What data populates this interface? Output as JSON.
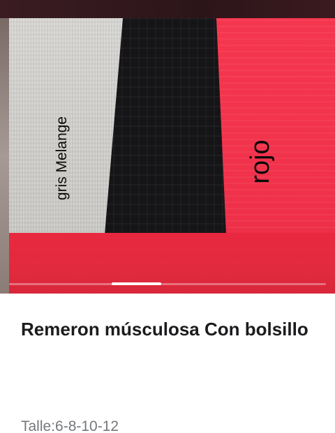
{
  "product": {
    "image": {
      "caption_left": "gris Melange",
      "caption_right": "rojo",
      "slide_index": 3,
      "colors": {
        "gray_fabric": "#d0cfcc",
        "black_fabric": "#151518",
        "red_fabric": "#f2334c"
      }
    },
    "title": "Remeron músculosa Con bolsillo",
    "sizes": "Talle:6-8-10-12"
  }
}
